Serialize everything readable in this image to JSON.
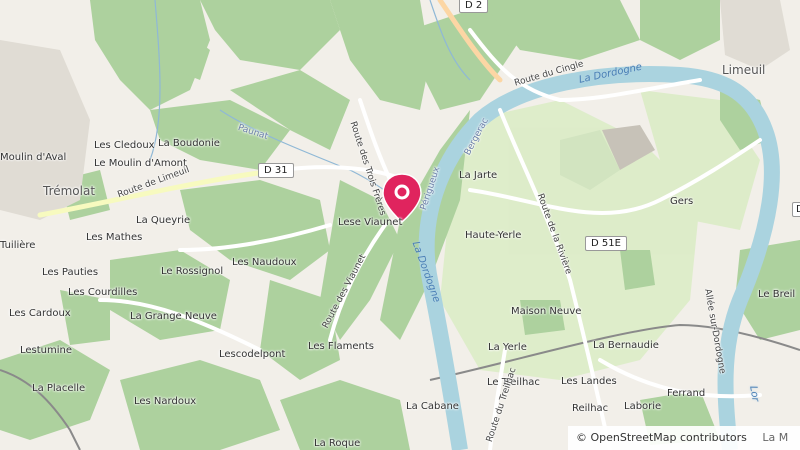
{
  "map": {
    "colors": {
      "background": "#f2efe9",
      "forest": "#add19e",
      "meadow": "#cdebb0",
      "water": "#aad3df",
      "road": "#ffffff",
      "marker": "#e0245e"
    },
    "towns": [
      {
        "name": "Trémolat"
      },
      {
        "name": "Limeuil"
      }
    ],
    "places": [
      {
        "name": "Moulin d'Aval"
      },
      {
        "name": "Les Cledoux"
      },
      {
        "name": "La Boudonie"
      },
      {
        "name": "Le Moulin d'Amont"
      },
      {
        "name": "La Queyrie"
      },
      {
        "name": "Les Mathes"
      },
      {
        "name": "Tuilière"
      },
      {
        "name": "Le Rossignol"
      },
      {
        "name": "Les Naudoux"
      },
      {
        "name": "Les Pauties"
      },
      {
        "name": "Les Courdilles"
      },
      {
        "name": "Les Cardoux"
      },
      {
        "name": "La Grange Neuve"
      },
      {
        "name": "Lestumine"
      },
      {
        "name": "Lescodelpont"
      },
      {
        "name": "Les Flaments"
      },
      {
        "name": "La Placelle"
      },
      {
        "name": "Les Nardoux"
      },
      {
        "name": "La Cabane"
      },
      {
        "name": "La Roque"
      },
      {
        "name": "Lese Viaunet"
      },
      {
        "name": "La Jarte"
      },
      {
        "name": "Haute-Yerle"
      },
      {
        "name": "Gers"
      },
      {
        "name": "Le Breil"
      },
      {
        "name": "Maison Neuve"
      },
      {
        "name": "La Yerle"
      },
      {
        "name": "La Bernaudie"
      },
      {
        "name": "Le Treilhac"
      },
      {
        "name": "Les Landes"
      },
      {
        "name": "Ferrand"
      },
      {
        "name": "Reilhac"
      },
      {
        "name": "Laborie"
      }
    ],
    "roads": [
      {
        "name": "Route de Limeuil"
      },
      {
        "name": "Route des Trois Frères"
      },
      {
        "name": "Route des Viaunet"
      },
      {
        "name": "Route du Cingle"
      },
      {
        "name": "Route de la Rivière"
      },
      {
        "name": "Route du Treilhac"
      },
      {
        "name": "Allée sur-Dordogne"
      }
    ],
    "shields": [
      {
        "ref": "D 2"
      },
      {
        "ref": "D 31"
      },
      {
        "ref": "D 51E"
      }
    ],
    "water_labels": [
      {
        "name": "La Dordogne"
      },
      {
        "name": "La Dordogne"
      },
      {
        "name": "Paunat"
      },
      {
        "name": "Bergerac"
      },
      {
        "name": "Périgueux"
      },
      {
        "name": "Lor"
      }
    ],
    "attribution": "© OpenStreetMap contributors",
    "edge_fragments": {
      "right_mid": "D",
      "bottom_right": "La M"
    }
  }
}
